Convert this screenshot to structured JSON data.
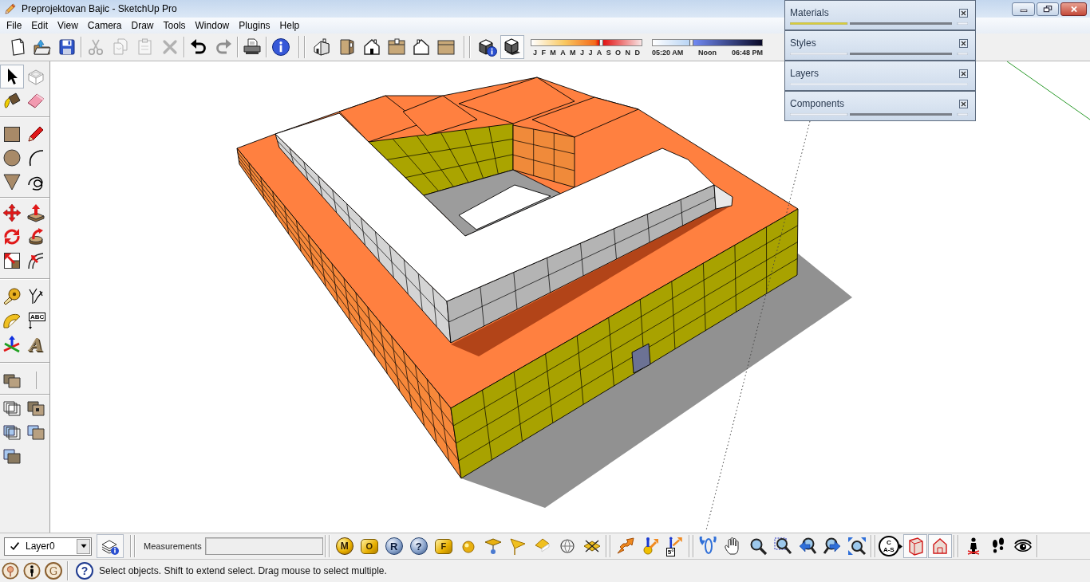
{
  "window": {
    "title": "Preprojektovan Bajic - SketchUp Pro"
  },
  "menu": [
    "File",
    "Edit",
    "View",
    "Camera",
    "Draw",
    "Tools",
    "Window",
    "Plugins",
    "Help"
  ],
  "toolbars": [
    [
      [
        {
          "kind": "new",
          "selected": false,
          "disabled": false
        },
        {
          "kind": "open",
          "selected": false,
          "disabled": false
        },
        {
          "kind": "save",
          "selected": false,
          "disabled": false
        }
      ],
      [
        {
          "kind": "cut",
          "selected": false,
          "disabled": true
        },
        {
          "kind": "copy",
          "selected": false,
          "disabled": true
        },
        {
          "kind": "paste",
          "selected": false,
          "disabled": true
        },
        {
          "kind": "erase",
          "selected": false,
          "disabled": true
        }
      ],
      [
        {
          "kind": "undo",
          "selected": false,
          "disabled": false
        },
        {
          "kind": "redo",
          "selected": false,
          "disabled": true
        }
      ],
      [
        {
          "kind": "print",
          "selected": false,
          "disabled": false
        }
      ],
      [
        {
          "kind": "info",
          "selected": false,
          "disabled": false
        }
      ]
    ],
    [
      [
        {
          "kind": "iso",
          "selected": false,
          "disabled": false
        },
        {
          "kind": "right",
          "selected": false,
          "disabled": false
        },
        {
          "kind": "front",
          "selected": false,
          "disabled": false
        },
        {
          "kind": "top",
          "selected": false,
          "disabled": false
        },
        {
          "kind": "back",
          "selected": false,
          "disabled": false
        },
        {
          "kind": "left",
          "selected": false,
          "disabled": false
        }
      ]
    ],
    [
      [
        {
          "kind": "shadowinfo",
          "selected": false,
          "disabled": false
        },
        {
          "kind": "shadowtoggle",
          "selected": true,
          "disabled": false
        }
      ]
    ]
  ],
  "shadows": {
    "months": [
      "J",
      "F",
      "M",
      "A",
      "M",
      "J",
      "J",
      "A",
      "S",
      "O",
      "N",
      "D"
    ],
    "month_slider": {
      "level": 0.63
    },
    "time_slider": {
      "level": 0.35
    },
    "times": [
      "05:20 AM",
      "Noon",
      "06:48 PM"
    ]
  },
  "tray": [
    {
      "title": "Materials",
      "kind": "split",
      "selected": true
    },
    {
      "title": "Styles",
      "kind": "split",
      "selected": false
    },
    {
      "title": "Layers",
      "kind": "plain",
      "selected": false
    },
    {
      "title": "Components",
      "kind": "split",
      "selected": false
    }
  ],
  "left_toolbar": [
    [
      {
        "kind": "select",
        "selected": true
      },
      {
        "kind": "component",
        "selected": false
      },
      {
        "kind": "paint",
        "selected": false
      },
      {
        "kind": "eraser",
        "selected": false
      }
    ],
    [
      {
        "kind": "rectangle",
        "selected": false
      },
      {
        "kind": "line",
        "selected": false
      },
      {
        "kind": "circle",
        "selected": false
      },
      {
        "kind": "arc",
        "selected": false
      },
      {
        "kind": "polygon",
        "selected": false
      },
      {
        "kind": "freehand",
        "selected": false
      }
    ],
    [
      {
        "kind": "move",
        "selected": false
      },
      {
        "kind": "pushpull",
        "selected": false
      },
      {
        "kind": "rotate",
        "selected": false
      },
      {
        "kind": "followme",
        "selected": false
      },
      {
        "kind": "scale",
        "selected": false
      },
      {
        "kind": "offset",
        "selected": false
      }
    ],
    [
      {
        "kind": "tape",
        "selected": false
      },
      {
        "kind": "dimension",
        "selected": false
      },
      {
        "kind": "protractor",
        "selected": false
      },
      {
        "kind": "text",
        "label": "ABC",
        "selected": false
      },
      {
        "kind": "axes",
        "selected": false
      },
      {
        "kind": "text3d",
        "label": "A",
        "selected": false
      }
    ],
    [
      {
        "kind": "section",
        "selected": false
      }
    ],
    [
      {
        "kind": "squaresa",
        "selected": false
      },
      {
        "kind": "squaresb",
        "selected": false
      },
      {
        "kind": "squaresc",
        "selected": false
      },
      {
        "kind": "squaresd",
        "selected": false
      },
      {
        "kind": "squarese",
        "selected": false
      }
    ]
  ],
  "layer": {
    "visible": true,
    "name": "Layer0"
  },
  "measurements": {
    "label": "Measurements"
  },
  "bottom_toolbar": [
    [
      {
        "kind": "coin",
        "label": "M",
        "selected": false
      },
      {
        "kind": "tag",
        "label": "O",
        "selected": false
      },
      {
        "kind": "orb",
        "label": "R",
        "selected": false
      },
      {
        "kind": "orb",
        "label": "?",
        "selected": false
      },
      {
        "kind": "tag",
        "label": "F",
        "selected": false
      },
      {
        "kind": "sphere",
        "selected": false
      },
      {
        "kind": "pinplane",
        "selected": false
      },
      {
        "kind": "flag",
        "selected": false
      },
      {
        "kind": "wedge",
        "selected": false
      },
      {
        "kind": "globe",
        "selected": false
      },
      {
        "kind": "crossplane",
        "selected": false
      }
    ],
    [
      {
        "kind": "sandbox",
        "selected": false
      },
      {
        "kind": "sunfigure",
        "selected": false
      },
      {
        "kind": "angle",
        "label": "5°",
        "selected": false
      }
    ],
    [
      {
        "kind": "orbit",
        "selected": false
      },
      {
        "kind": "pan",
        "selected": false
      },
      {
        "kind": "zoom",
        "selected": false
      },
      {
        "kind": "zoomwindow",
        "selected": false
      },
      {
        "kind": "previous",
        "selected": false
      },
      {
        "kind": "next",
        "selected": false
      },
      {
        "kind": "extents",
        "selected": false
      }
    ],
    [
      {
        "kind": "compass",
        "labels": [
          "C",
          "A-S"
        ],
        "selected": false
      },
      {
        "kind": "planes",
        "selected": true
      },
      {
        "kind": "cuts",
        "selected": true
      }
    ],
    [
      {
        "kind": "position",
        "selected": false
      },
      {
        "kind": "walk",
        "selected": false
      },
      {
        "kind": "look",
        "selected": false
      }
    ]
  ],
  "status_bar": {
    "buttons": [
      {
        "kind": "pin"
      },
      {
        "kind": "person"
      },
      {
        "kind": "letter",
        "label": "G"
      }
    ],
    "help": "?",
    "message": "Select objects. Shift to extend select. Drag mouse to select multiple."
  }
}
